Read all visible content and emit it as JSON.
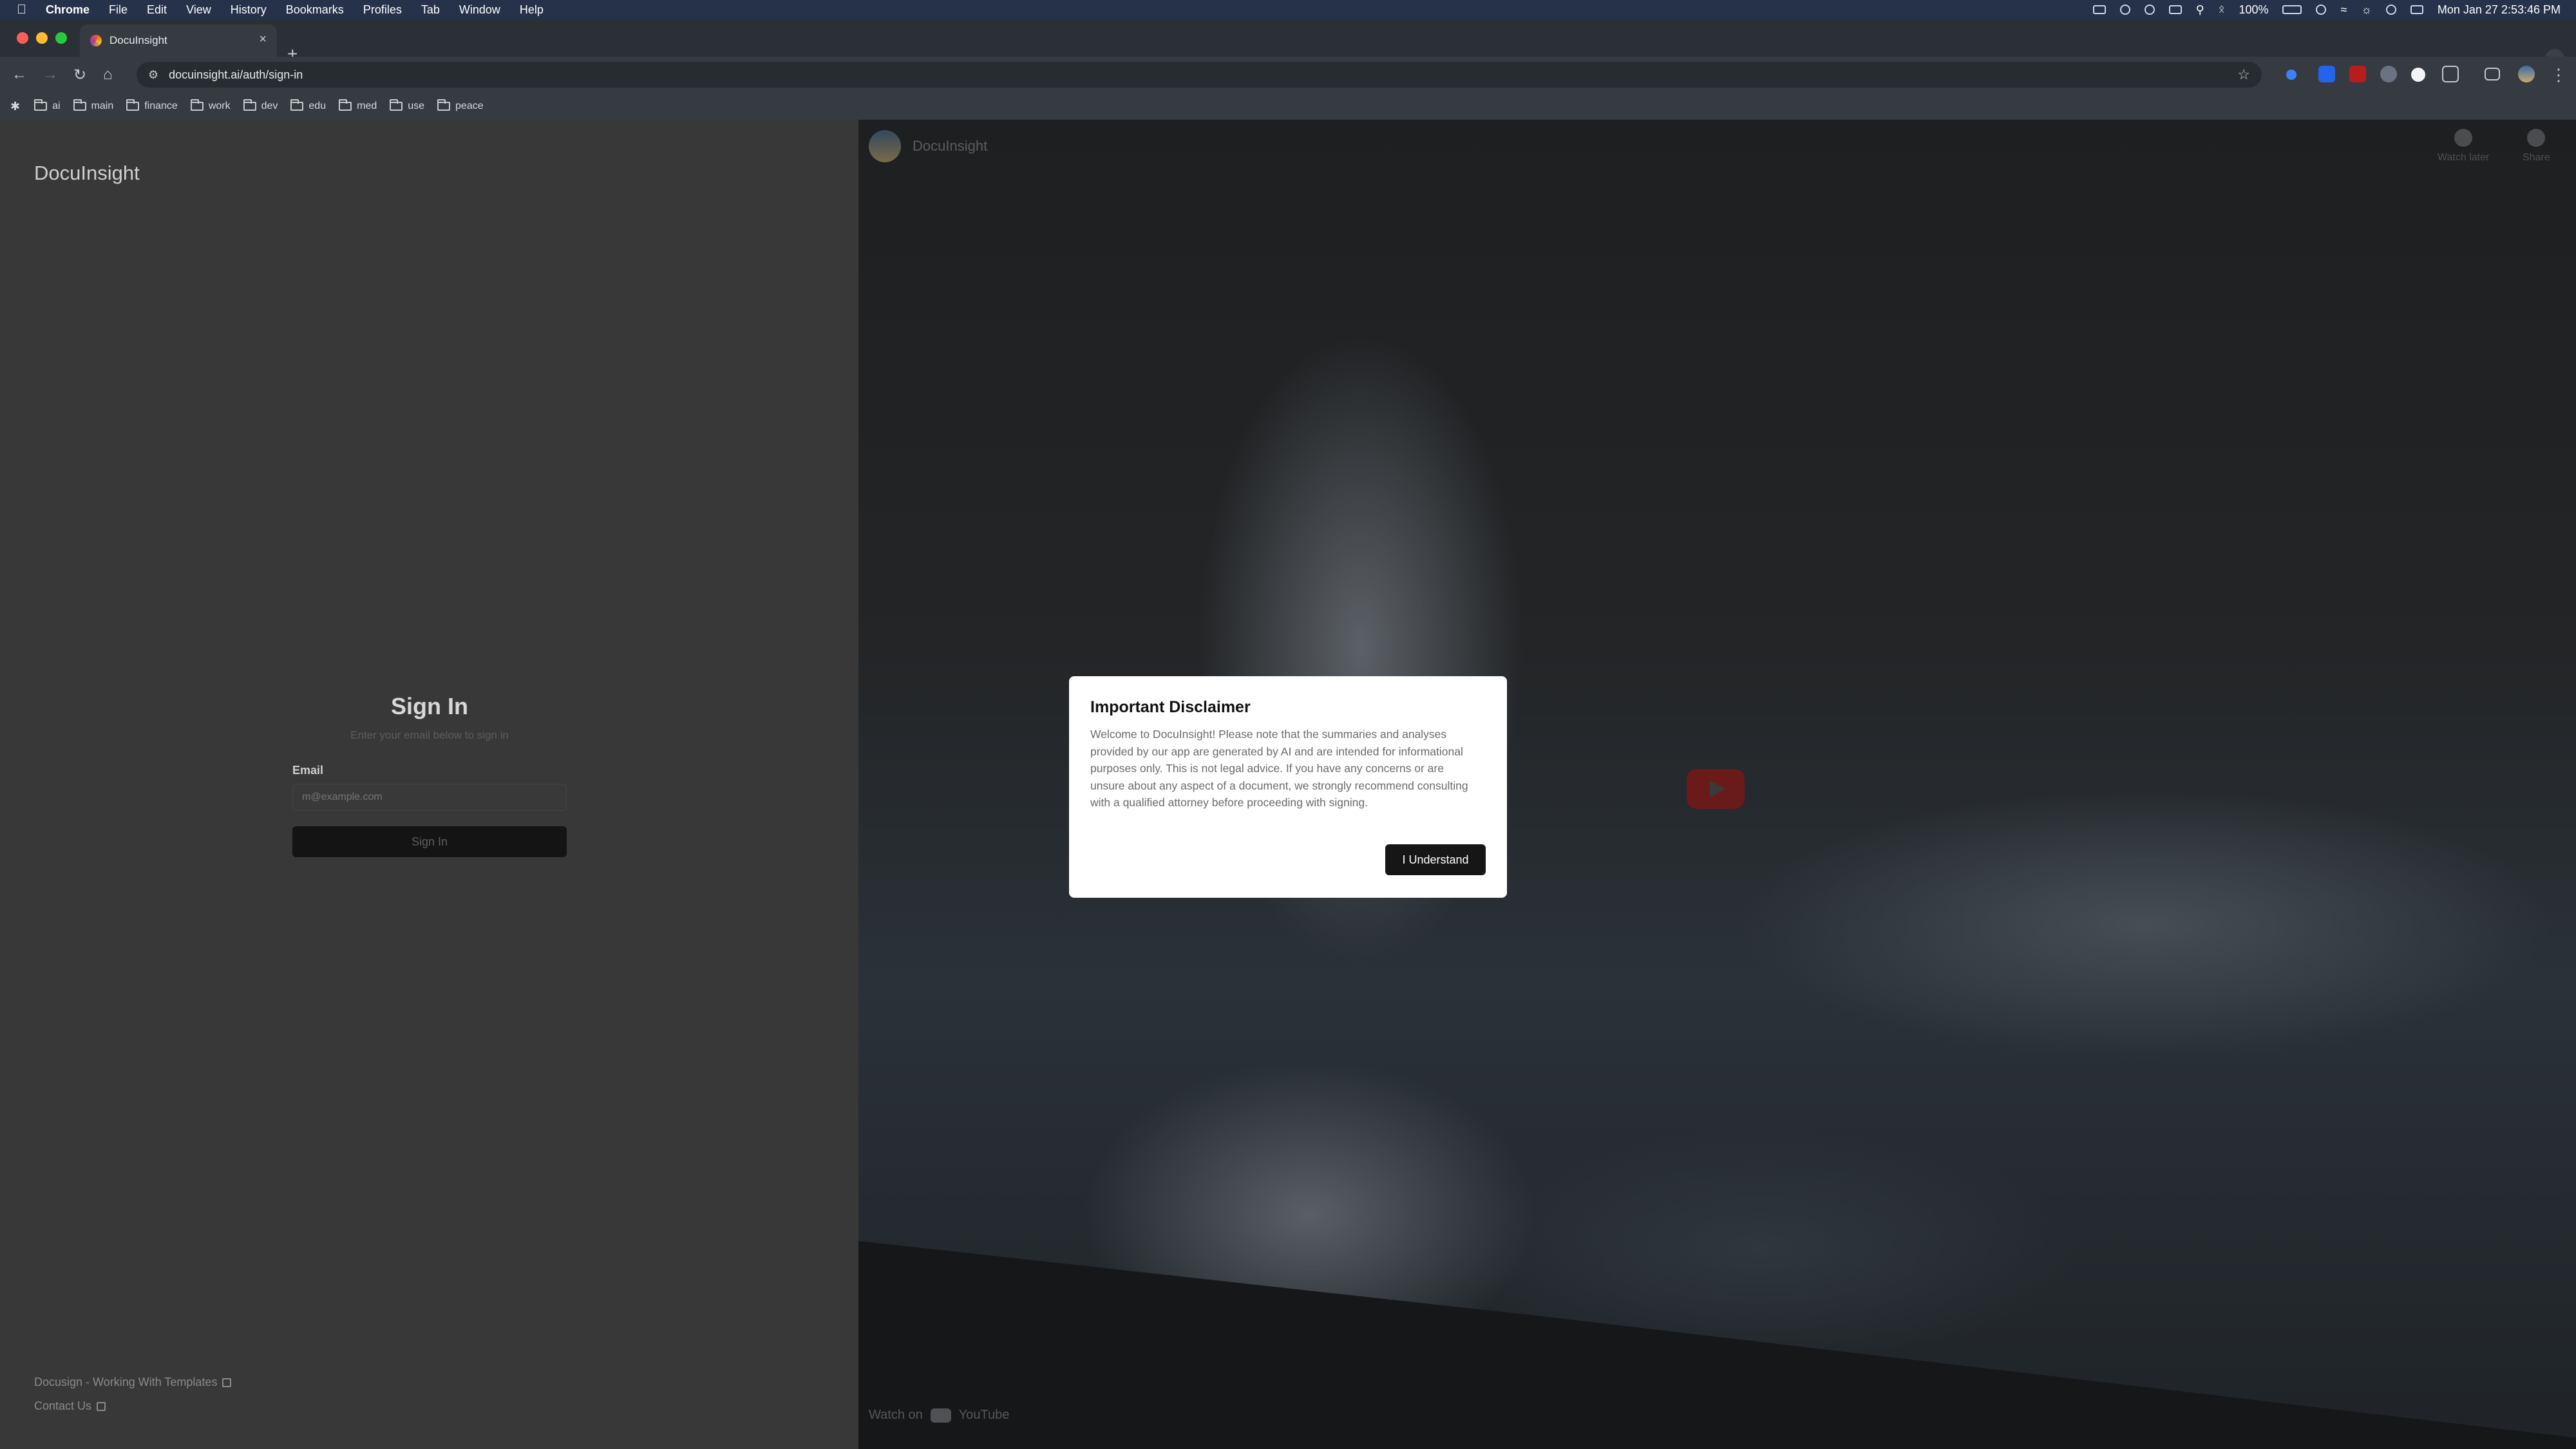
{
  "menubar": {
    "app": "Chrome",
    "items": [
      "File",
      "Edit",
      "View",
      "History",
      "Bookmarks",
      "Profiles",
      "Tab",
      "Window",
      "Help"
    ],
    "battery": "100%",
    "datetime": "Mon Jan 27  2:53:46 PM"
  },
  "browser": {
    "tab_title": "DocuInsight",
    "url": "docuinsight.ai/auth/sign-in",
    "bookmarks": [
      "ai",
      "main",
      "finance",
      "work",
      "dev",
      "edu",
      "med",
      "use",
      "peace"
    ]
  },
  "left": {
    "brand": "DocuInsight",
    "signin_title": "Sign In",
    "signin_subtitle": "Enter your email below to sign in",
    "email_label": "Email",
    "email_placeholder": "m@example.com",
    "signin_button": "Sign In",
    "footer_links": [
      "Docusign - Working With Templates",
      "Contact Us"
    ]
  },
  "video": {
    "channel": "DocuInsight",
    "watch_later": "Watch later",
    "share": "Share",
    "watch_on": "Watch on",
    "youtube": "YouTube"
  },
  "modal": {
    "title": "Important Disclaimer",
    "body": "Welcome to DocuInsight! Please note that the summaries and analyses provided by our app are generated by AI and are intended for informational purposes only. This is not legal advice. If you have any concerns or are unsure about any aspect of a document, we strongly recommend consulting with a qualified attorney before proceeding with signing.",
    "button": "I Understand"
  }
}
